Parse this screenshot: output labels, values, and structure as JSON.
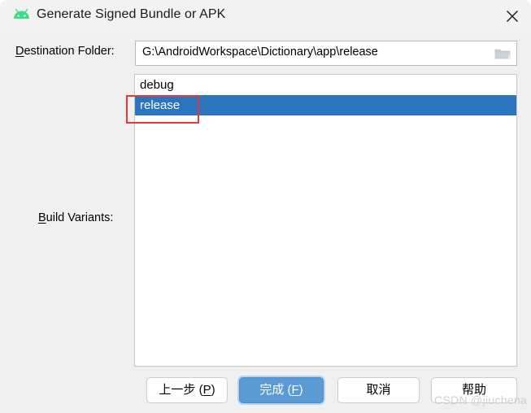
{
  "window": {
    "title": "Generate Signed Bundle or APK",
    "app_icon": "android-robot-icon",
    "close_icon": "close-icon",
    "accent_selection_color": "#2b74be",
    "default_button_color": "#5b9bd5",
    "annotation_color": "#e03a3a",
    "background_color": "#f0f0f0"
  },
  "destination": {
    "label_prefix": "D",
    "label_rest": "estination Folder:",
    "value": "G:\\AndroidWorkspace\\Dictionary\\app\\release",
    "placeholder": "",
    "browse_icon": "folder-icon"
  },
  "build_variants": {
    "label_prefix": "B",
    "label_rest": "uild Variants:",
    "items": [
      {
        "name": "debug",
        "selected": false
      },
      {
        "name": "release",
        "selected": true
      }
    ]
  },
  "buttons": {
    "previous": {
      "text": "上一步 (",
      "mnemonic": "P",
      "suffix": ")"
    },
    "finish": {
      "text": "完成 (",
      "mnemonic": "F",
      "suffix": ")"
    },
    "cancel": {
      "text": "取消",
      "mnemonic": "",
      "suffix": ""
    },
    "help": {
      "text": "帮助",
      "mnemonic": "",
      "suffix": ""
    }
  },
  "watermark": {
    "text": "CSDN @jiuchena"
  }
}
